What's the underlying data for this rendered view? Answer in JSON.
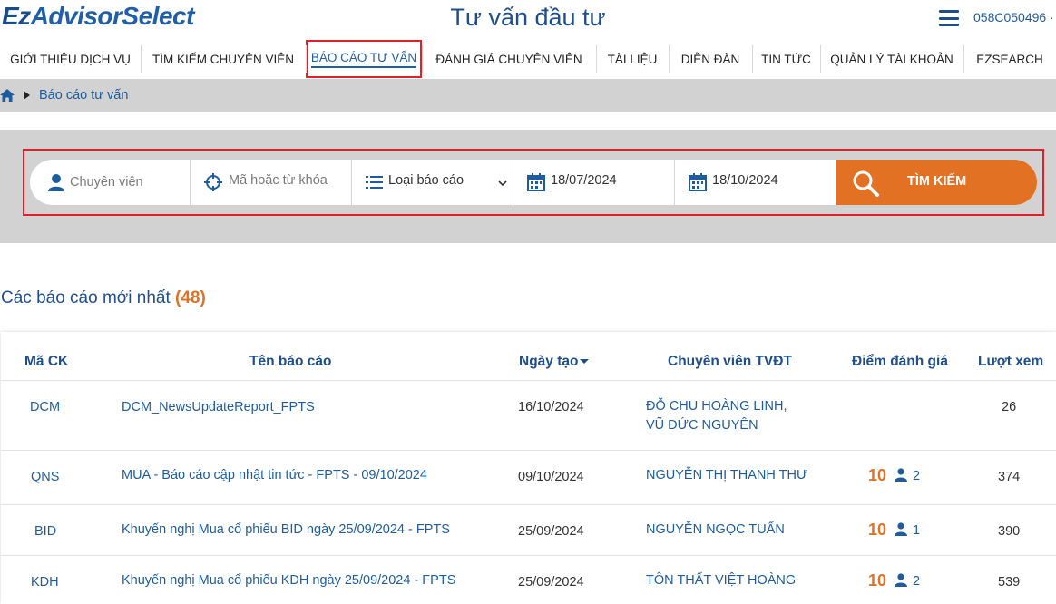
{
  "header": {
    "logo_ez": "Ez",
    "logo_rest": "AdvisorSelect",
    "title": "Tư vấn đầu tư",
    "account": "058C050496 ·"
  },
  "nav": {
    "items": [
      {
        "label": "GIỚI THIỆU DỊCH VỤ"
      },
      {
        "label": "TÌM KIẾM CHUYÊN VIÊN"
      },
      {
        "label": "BÁO CÁO TƯ VẤN"
      },
      {
        "label": "ĐÁNH GIÁ CHUYÊN VIÊN"
      },
      {
        "label": "TÀI LIỆU"
      },
      {
        "label": "DIỄN ĐÀN"
      },
      {
        "label": "TIN TỨC"
      },
      {
        "label": "QUẢN LÝ TÀI KHOẢN"
      },
      {
        "label": "EZSEARCH"
      }
    ],
    "active": "BÁO CÁO TƯ VẤN"
  },
  "breadcrumb": {
    "current": "Báo cáo tư vấn"
  },
  "search": {
    "expert_placeholder": "Chuyên viên",
    "keyword_placeholder": "Mã hoặc từ khóa",
    "type_selected": "Loại báo cáo",
    "from_date": "18/07/2024",
    "to_date": "18/10/2024",
    "button_label": "TÌM KIẾM"
  },
  "section": {
    "title": "Các báo cáo mới nhất",
    "count": "(48)"
  },
  "table": {
    "headers": {
      "code": "Mã CK",
      "name": "Tên báo cáo",
      "date": "Ngày tạo",
      "expert": "Chuyên viên TVĐT",
      "score": "Điểm đánh giá",
      "views": "Lượt xem"
    },
    "rows": [
      {
        "code": "DCM",
        "name": "DCM_NewsUpdateReport_FPTS",
        "date": "16/10/2024",
        "expert_line1": "ĐỖ CHU HOÀNG LINH,",
        "expert_line2": "VŨ ĐỨC NGUYÊN",
        "score": "",
        "votes": "",
        "views": "26"
      },
      {
        "code": "QNS",
        "name": "MUA - Báo cáo cập nhật tin tức - FPTS - 09/10/2024",
        "date": "09/10/2024",
        "expert_line1": "NGUYỄN THỊ THANH THƯ",
        "expert_line2": "",
        "score": "10",
        "votes": "2",
        "views": "374"
      },
      {
        "code": "BID",
        "name": "Khuyến nghị Mua cổ phiếu BID ngày 25/09/2024 - FPTS",
        "date": "25/09/2024",
        "expert_line1": "NGUYỄN NGỌC TUẤN",
        "expert_line2": "",
        "score": "10",
        "votes": "1",
        "views": "390"
      },
      {
        "code": "KDH",
        "name": "Khuyến nghị Mua cổ phiếu KDH ngày 25/09/2024 - FPTS",
        "date": "25/09/2024",
        "expert_line1": "TÔN THẤT VIỆT HOÀNG",
        "expert_line2": "",
        "score": "10",
        "votes": "2",
        "views": "539"
      }
    ]
  },
  "colors": {
    "brand_blue": "#1e4e8c",
    "accent_orange": "#e27124",
    "highlight_red": "#e0202a",
    "panel_gray": "#d2d2d2"
  },
  "icons": {
    "menu": "hamburger-menu-icon",
    "home": "home-icon",
    "expert": "user-icon",
    "keyword": "crosshair-icon",
    "type": "list-icon",
    "date": "calendar-icon",
    "search": "magnifier-icon",
    "votes": "user-icon"
  }
}
